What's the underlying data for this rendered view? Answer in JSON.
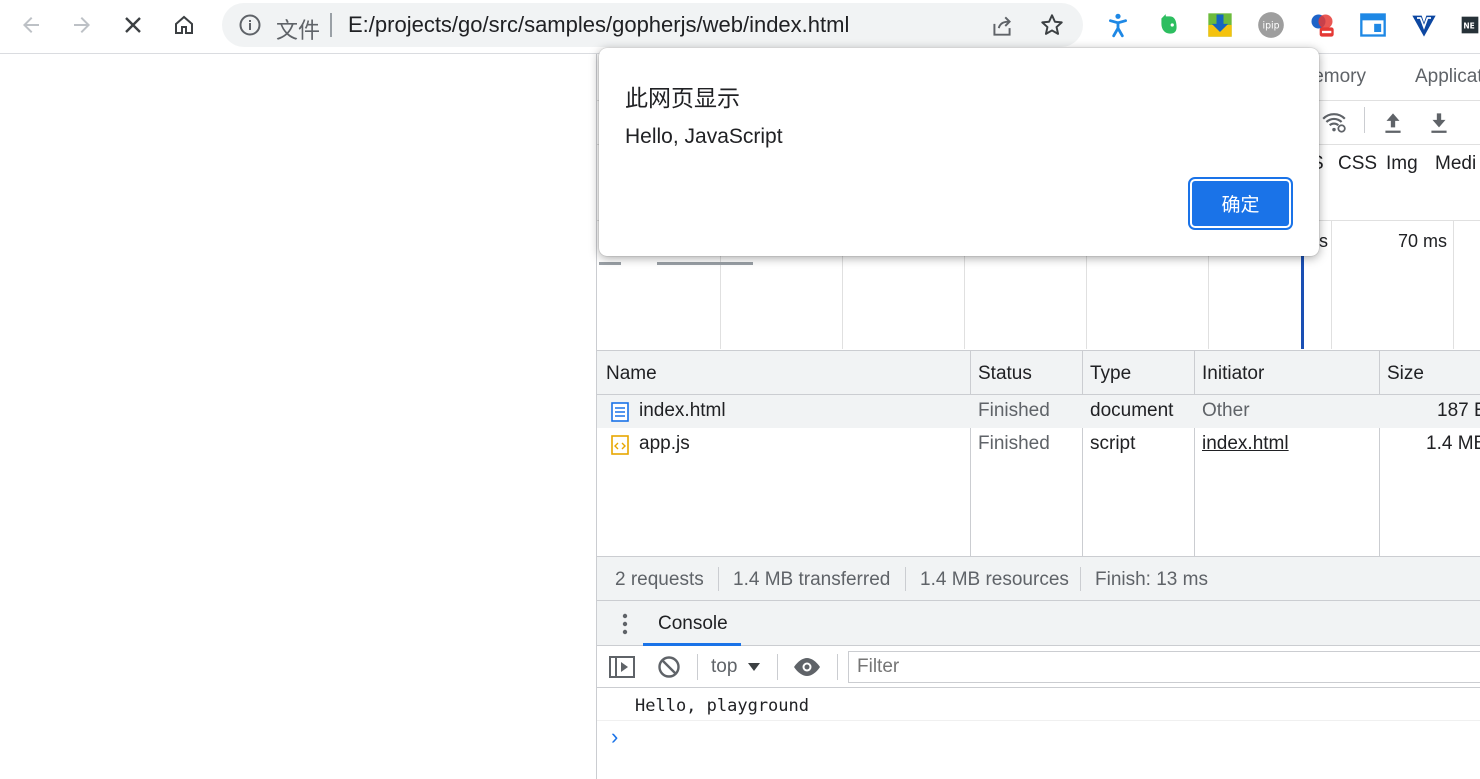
{
  "browser": {
    "security_label": "文件",
    "url": "E:/projects/go/src/samples/gopherjs/web/index.html"
  },
  "icons": {
    "back": "back-arrow-icon",
    "forward": "forward-arrow-icon",
    "stop": "stop-loading-icon",
    "home": "home-icon",
    "info": "info-icon",
    "share": "share-icon",
    "bookmark": "star-icon"
  },
  "extensions": [
    "accessibility-icon",
    "evernote-icon",
    "download-arrow-icon",
    "ipip-icon",
    "extension-badge-icon",
    "window-icon",
    "heart-logo-icon",
    "news-icon"
  ],
  "extension_labels": {
    "ipip": "ipip",
    "news": "NE"
  },
  "devtools": {
    "tabs": [
      "lemory",
      "Applicat"
    ],
    "filter_types": [
      "S",
      "CSS",
      "Img",
      "Medi"
    ],
    "overview_labels": [
      "s",
      "70 ms"
    ],
    "network": {
      "columns": [
        "Name",
        "Status",
        "Type",
        "Initiator",
        "Size"
      ],
      "rows": [
        {
          "name": "index.html",
          "status": "Finished",
          "type": "document",
          "initiator": "Other",
          "size": "187 E",
          "icon": "document-icon"
        },
        {
          "name": "app.js",
          "status": "Finished",
          "type": "script",
          "initiator": "index.html",
          "size": "1.4 MB",
          "icon": "script-icon"
        }
      ],
      "footer": [
        "2 requests",
        "1.4 MB transferred",
        "1.4 MB resources",
        "Finish: 13 ms"
      ]
    },
    "drawer": {
      "tab": "Console",
      "context": "top",
      "filter_placeholder": "Filter",
      "messages": [
        "Hello, playground"
      ],
      "prompt": "›"
    }
  },
  "dialog": {
    "title": "此网页显示",
    "message": "Hello, JavaScript",
    "ok_label": "确定"
  },
  "colors": {
    "accent": "#1a73e8",
    "timeline_marker": "#1a4fb4"
  }
}
